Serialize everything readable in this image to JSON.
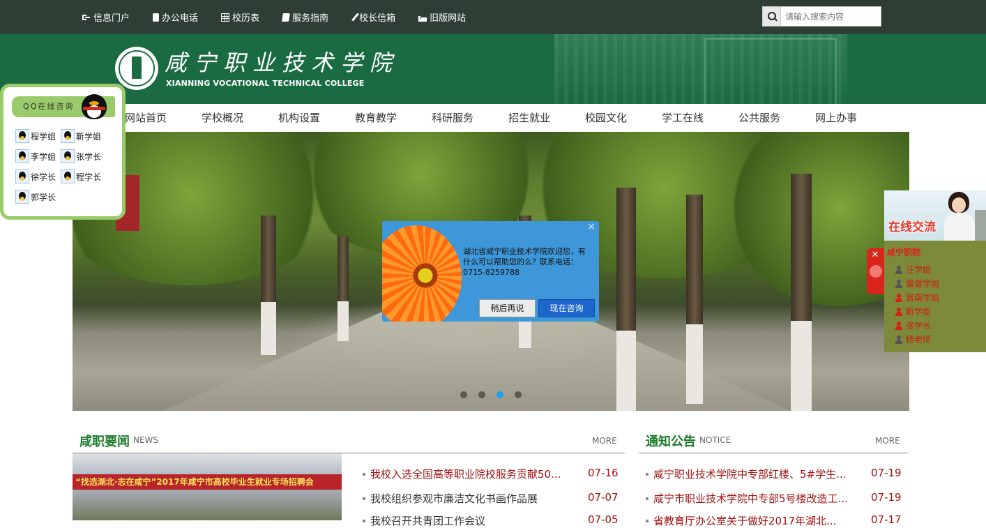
{
  "topnav": {
    "items": [
      {
        "label": "信息门户",
        "icon": "sign-in-icon"
      },
      {
        "label": "办公电话",
        "icon": "phone-icon"
      },
      {
        "label": "校历表",
        "icon": "calendar-table-icon"
      },
      {
        "label": "服务指南",
        "icon": "book-icon"
      },
      {
        "label": "校长信箱",
        "icon": "pencil-icon"
      },
      {
        "label": "旧版网站",
        "icon": "bed-icon"
      }
    ],
    "search_placeholder": "请输入搜索内容"
  },
  "brand": {
    "name_cn": "咸宁职业技术学院",
    "name_en": "XIANNING VOCATIONAL TECHNICAL COLLEGE"
  },
  "mainnav": {
    "items": [
      "网站首页",
      "学校概况",
      "机构设置",
      "教育教学",
      "科研服务",
      "招生就业",
      "校园文化",
      "学工在线",
      "公共服务",
      "网上办事"
    ]
  },
  "slider": {
    "dot_count": 4,
    "active_index": 3
  },
  "qq_panel": {
    "title": "QQ在线咨询",
    "contacts": [
      "程学姐",
      "靳学姐",
      "李学姐",
      "张学长",
      "徐学长",
      "程学长",
      "郭学长"
    ]
  },
  "popup": {
    "message": "湖北省咸宁职业技术学院欢迎您，有什么可以帮助您的么？联系电话：0715-8259788",
    "later_label": "稍后再说",
    "now_label": "现在咨询",
    "close_glyph": "✕"
  },
  "chat_panel": {
    "title": "在线交流",
    "org": "咸宁职院",
    "close_glyph": "✕",
    "contacts": [
      {
        "name": "汪学姐",
        "online": false
      },
      {
        "name": "雷雷学姐",
        "online": false
      },
      {
        "name": "晋南学姐",
        "online": true
      },
      {
        "name": "靳学姐",
        "online": true
      },
      {
        "name": "张学长",
        "online": true
      },
      {
        "name": "杨老师",
        "online": false
      }
    ]
  },
  "news": {
    "title": "咸职要闻",
    "subtitle": "NEWS",
    "more": "MORE",
    "photo_caption": "“找选湖北·志在咸宁”2017年咸宁市高校毕业生就业专场招聘会",
    "items": [
      {
        "text": "我校入选全国高等职业院校服务贡献50...",
        "date": "07-16",
        "color": "#a11212"
      },
      {
        "text": "我校组织参观市廉洁文化书画作品展",
        "date": "07-07",
        "color": "#333333"
      },
      {
        "text": "我校召开共青团工作会议",
        "date": "07-05",
        "color": "#333333"
      }
    ]
  },
  "notice": {
    "title": "通知公告",
    "subtitle": "NOTICE",
    "more": "MORE",
    "items": [
      {
        "text": "咸宁职业技术学院中专部红楼、5#学生...",
        "date": "07-19",
        "color": "#a11212"
      },
      {
        "text": "咸宁市职业技术学院中专部5号楼改造工...",
        "date": "07-19",
        "color": "#a11212"
      },
      {
        "text": "省教育厅办公室关于做好2017年湖北...",
        "date": "07-17",
        "color": "#a11212"
      }
    ]
  }
}
